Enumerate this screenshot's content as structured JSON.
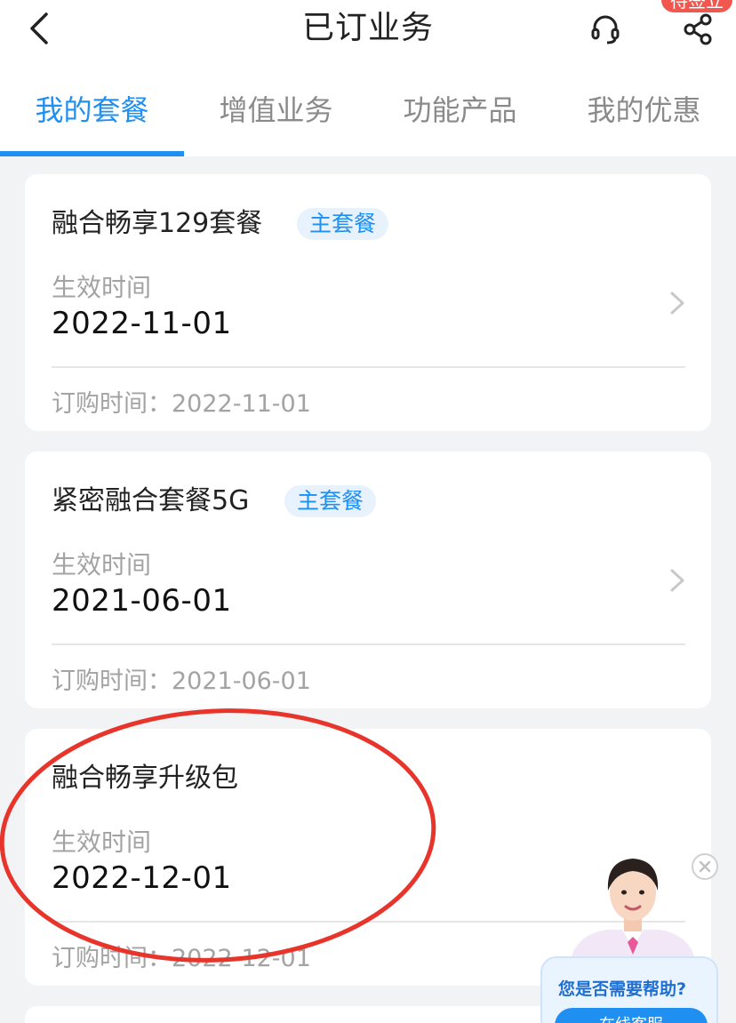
{
  "header": {
    "title": "已订业务",
    "corner_badge": "待签立",
    "back_icon": "chevron-left-icon",
    "service_icon": "headset-icon",
    "share_icon": "share-icon"
  },
  "tabs": [
    {
      "label": "我的套餐",
      "active": true
    },
    {
      "label": "增值业务",
      "active": false
    },
    {
      "label": "功能产品",
      "active": false
    },
    {
      "label": "我的优惠",
      "active": false
    }
  ],
  "packages": [
    {
      "name": "融合畅享129套餐",
      "tag": "主套餐",
      "effective_label": "生效时间",
      "effective_date": "2022-11-01",
      "order_text": "订购时间：2022-11-01"
    },
    {
      "name": "紧密融合套餐5G",
      "tag": "主套餐",
      "effective_label": "生效时间",
      "effective_date": "2021-06-01",
      "order_text": "订购时间：2021-06-01"
    },
    {
      "name": "融合畅享升级包",
      "tag": "",
      "effective_label": "生效时间",
      "effective_date": "2022-12-01",
      "order_text": "订购时间：2022-12-01"
    }
  ],
  "helper": {
    "question": "您是否需要帮助?",
    "button_label": "在线客服"
  },
  "colors": {
    "accent": "#1f8ff2",
    "annotation": "#e8352c",
    "badge": "#f0584f"
  }
}
